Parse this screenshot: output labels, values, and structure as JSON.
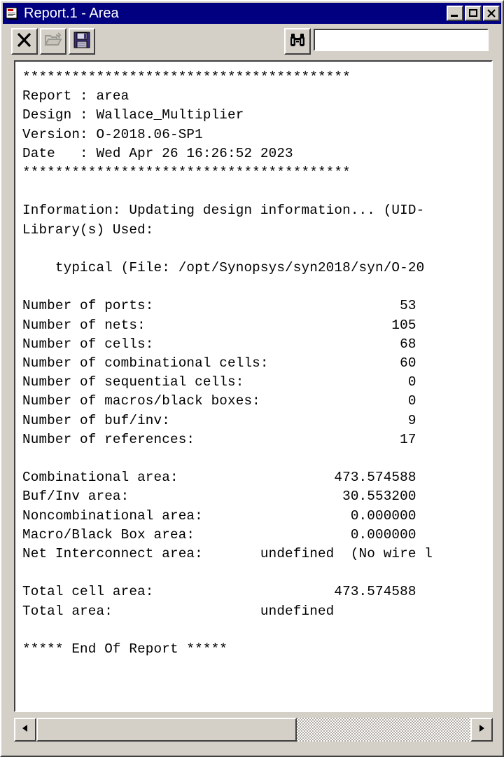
{
  "window": {
    "title": "Report.1 - Area",
    "icon": "report-document-icon",
    "titlebar_color": "#000080",
    "face_color": "#d4d0c8",
    "controls": {
      "minimize_label": "_",
      "maximize_label": "□",
      "close_label": "✕"
    }
  },
  "toolbar": {
    "buttons": [
      {
        "name": "close-report-button",
        "icon": "x-icon",
        "label": "✕",
        "enabled": true
      },
      {
        "name": "open-file-button",
        "icon": "open-folder-icon",
        "label": "",
        "enabled": false
      },
      {
        "name": "save-file-button",
        "icon": "floppy-disk-save-icon",
        "label": "",
        "enabled": true
      }
    ],
    "find_button": {
      "name": "find-button",
      "icon": "binoculars-icon"
    },
    "search": {
      "value": "",
      "placeholder": ""
    }
  },
  "report": {
    "text": "****************************************\nReport : area\nDesign : Wallace_Multiplier\nVersion: O-2018.06-SP1\nDate   : Wed Apr 26 16:26:52 2023\n****************************************\n\nInformation: Updating design information... (UID-\nLibrary(s) Used:\n\n    typical (File: /opt/Synopsys/syn2018/syn/O-20\n\nNumber of ports:                              53\nNumber of nets:                              105\nNumber of cells:                              68\nNumber of combinational cells:                60\nNumber of sequential cells:                    0\nNumber of macros/black boxes:                  0\nNumber of buf/inv:                             9\nNumber of references:                         17\n\nCombinational area:                   473.574588\nBuf/Inv area:                          30.553200\nNoncombinational area:                  0.000000\nMacro/Black Box area:                   0.000000\nNet Interconnect area:       undefined  (No wire l\n\nTotal cell area:                      473.574588\nTotal area:                  undefined\n\n***** End Of Report *****",
    "header": {
      "separator": "****************************************",
      "report": "Report : area",
      "design": "Design : Wallace_Multiplier",
      "version": "Version: O-2018.06-SP1",
      "date": "Date   : Wed Apr 26 16:26:52 2023"
    },
    "info_line": "Information: Updating design information... (UID-",
    "libraries_label": "Library(s) Used:",
    "library_entry": "    typical (File: /opt/Synopsys/syn2018/syn/O-20",
    "counts": [
      {
        "label": "Number of ports:",
        "value": "53"
      },
      {
        "label": "Number of nets:",
        "value": "105"
      },
      {
        "label": "Number of cells:",
        "value": "68"
      },
      {
        "label": "Number of combinational cells:",
        "value": "60"
      },
      {
        "label": "Number of sequential cells:",
        "value": "0"
      },
      {
        "label": "Number of macros/black boxes:",
        "value": "0"
      },
      {
        "label": "Number of buf/inv:",
        "value": "9"
      },
      {
        "label": "Number of references:",
        "value": "17"
      }
    ],
    "areas": [
      {
        "label": "Combinational area:",
        "value": "473.574588"
      },
      {
        "label": "Buf/Inv area:",
        "value": "30.553200"
      },
      {
        "label": "Noncombinational area:",
        "value": "0.000000"
      },
      {
        "label": "Macro/Black Box area:",
        "value": "0.000000"
      },
      {
        "label": "Net Interconnect area:",
        "value": "undefined  (No wire l"
      }
    ],
    "totals": [
      {
        "label": "Total cell area:",
        "value": "473.574588"
      },
      {
        "label": "Total area:",
        "value": "undefined"
      }
    ],
    "footer": "***** End Of Report *****"
  },
  "scrollbar": {
    "left_arrow": "◄",
    "right_arrow": "►",
    "thumb_percent": "60"
  }
}
